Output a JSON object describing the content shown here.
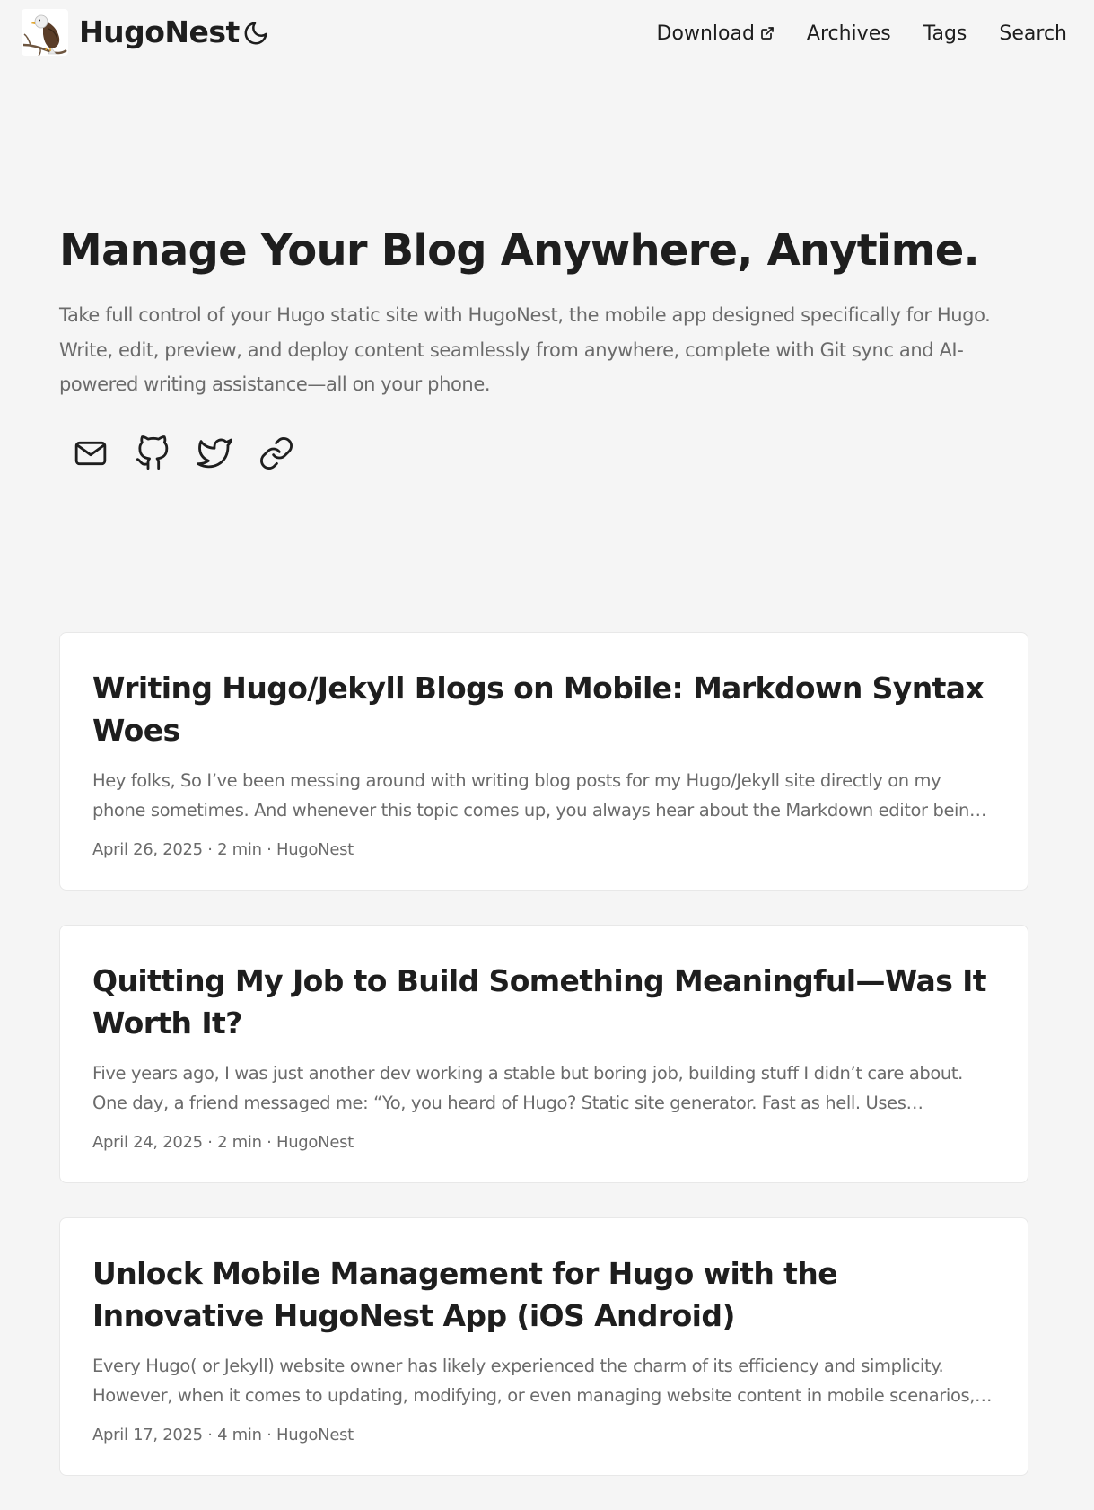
{
  "header": {
    "site_name": "HugoNest",
    "logo_icon": "eagle-logo",
    "theme_toggle_icon": "moon-icon",
    "nav": [
      {
        "label": "Download",
        "external": true
      },
      {
        "label": "Archives"
      },
      {
        "label": "Tags"
      },
      {
        "label": "Search"
      }
    ]
  },
  "hero": {
    "title": "Manage Your Blog Anywhere, Anytime.",
    "description": "Take full control of your Hugo static site with HugoNest, the mobile app designed specifically for Hugo. Write, edit, preview, and deploy content seamlessly from anywhere, complete with Git sync and AI-powered writing assistance—all on your phone.",
    "social_icons": [
      "email-icon",
      "github-icon",
      "twitter-icon",
      "link-icon"
    ]
  },
  "posts": [
    {
      "title": "Writing Hugo/Jekyll Blogs on Mobile: Markdown Syntax Woes",
      "excerpt": "Hey folks, So I’ve been messing around with writing blog posts for my Hugo/Jekyll site directly on my phone sometimes. And whenever this topic comes up, you always hear about the Markdown editor being clunky, …",
      "meta": "April 26, 2025 · 2 min · HugoNest"
    },
    {
      "title": "Quitting My Job to Build Something Meaningful—Was It Worth It?",
      "excerpt": "Five years ago, I was just another dev working a stable but boring job, building stuff I didn’t care about. One day, a friend messaged me: “Yo, you heard of Hugo? Static site generator. Fast as hell. Uses Markdown.” I…",
      "meta": "April 24, 2025 · 2 min · HugoNest"
    },
    {
      "title": "Unlock Mobile Management for Hugo with the Innovative HugoNest App (iOS Android)",
      "excerpt": "Every Hugo( or Jekyll) website owner has likely experienced the charm of its efficiency and simplicity. However, when it comes to updating, modifying, or even managing website content in mobile scenarios, t…",
      "meta": "April 17, 2025 · 4 min · HugoNest"
    }
  ]
}
